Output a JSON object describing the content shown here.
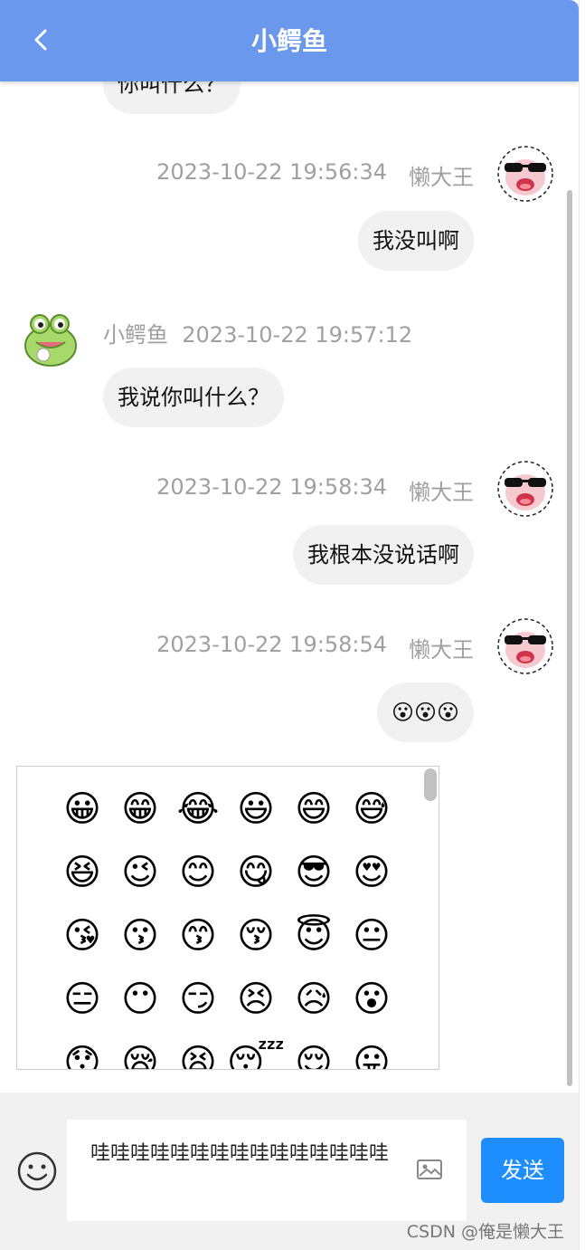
{
  "header": {
    "title": "小鳄鱼"
  },
  "messages": {
    "m0": {
      "text": "你叫什么？"
    },
    "m1": {
      "time": "2023-10-22 19:56:34",
      "name": "懒大王",
      "text": "我没叫啊"
    },
    "m2": {
      "name": "小鳄鱼",
      "time": "2023-10-22 19:57:12",
      "text": "我说你叫什么？"
    },
    "m3": {
      "time": "2023-10-22 19:58:34",
      "name": "懒大王",
      "text": "我根本没说话啊"
    },
    "m4": {
      "time": "2023-10-22 19:58:54",
      "name": "懒大王",
      "text": "😮😮😮"
    }
  },
  "emoji_panel": {
    "emojis": [
      "😀",
      "😁",
      "😂",
      "😃",
      "😄",
      "😅",
      "😆",
      "😉",
      "😊",
      "😋",
      "😎",
      "😍",
      "😘",
      "😗",
      "😙",
      "😚",
      "😇",
      "😐",
      "😑",
      "😶",
      "😏",
      "😣",
      "😥",
      "😮",
      "😯",
      "😪",
      "😫",
      "😴",
      "😌",
      "😛"
    ]
  },
  "composer": {
    "input_value": "哇哇哇哇哇哇哇哇哇哇哇哇哇哇哇",
    "send_label": "发送"
  },
  "watermark": "CSDN @俺是懒大王",
  "colors": {
    "header": "#6a98ec",
    "send_button": "#1e8eff",
    "bubble": "#f1f1f1",
    "meta_text": "#a0a0a0"
  },
  "icons": {
    "back": "chevron-left-icon",
    "emoji": "smiley-face-icon",
    "image": "image-icon"
  }
}
